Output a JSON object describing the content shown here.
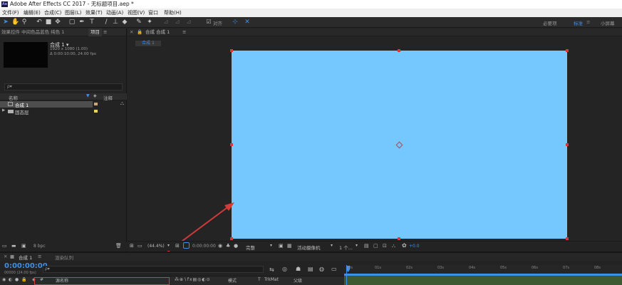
{
  "app": {
    "title": "Adobe After Effects CC 2017 - 无标题项目.aep *",
    "logo": "Ae"
  },
  "menu": [
    "文件(F)",
    "编辑(E)",
    "合成(C)",
    "图层(L)",
    "效果(T)",
    "动画(A)",
    "视图(V)",
    "窗口",
    "帮助(H)"
  ],
  "toolbar": {
    "tools": [
      "selection-tool",
      "hand-tool",
      "zoom-tool",
      "rotate-tool",
      "camera-tool",
      "pan-behind-tool",
      "rectangle-tool",
      "pen-tool",
      "type-tool",
      "brush-tool",
      "clone-stamp-tool",
      "eraser-tool",
      "roto-brush-tool",
      "puppet-tool"
    ],
    "snap_label": "对齐",
    "workspaces": [
      "必要项",
      "标准",
      "小屏幕"
    ],
    "active_workspace": "标准"
  },
  "project_panel": {
    "tab_effects": "效果控件 中间色品蓝色 纯色 1",
    "tab_project": "项目",
    "comp_name": "合成 1 ▾",
    "comp_size": "1920 x 1080 (1.00)",
    "comp_duration": "Δ 0:00:10:00, 24.00 fps",
    "search_placeholder": "ρ▾",
    "col_name": "名称",
    "col_comment": "注释",
    "items": [
      {
        "name": "合成 1",
        "color": "#c8a87a"
      },
      {
        "name": "固态层",
        "color": "#e8d45a"
      }
    ],
    "bpc": "8 bpc"
  },
  "composition": {
    "tab_label": "合成 1",
    "panel_title": "合成 合成 1",
    "canvas_color": "#75c8fe",
    "zoom": "(44.4%)",
    "timecode": "0:00:00:00",
    "resolution": "完整",
    "camera": "活动摄像机",
    "views": "1 个...",
    "exposure": "+0.0"
  },
  "timeline": {
    "tab_comp": "合成 1",
    "tab_render": "渲染队列",
    "timecode": "0:00:00:00",
    "frames": "00000 (24.00 fps)",
    "search_placeholder": "ρ▾",
    "ruler_marks": [
      "00s",
      "01s",
      "02s",
      "03s",
      "04s",
      "05s",
      "06s",
      "07s",
      "08s"
    ],
    "layer_head": {
      "hash": "#",
      "source_name": "源名称",
      "mode": "模式",
      "t": "T",
      "trkmat": "TrkMat",
      "parent": "父级"
    }
  }
}
